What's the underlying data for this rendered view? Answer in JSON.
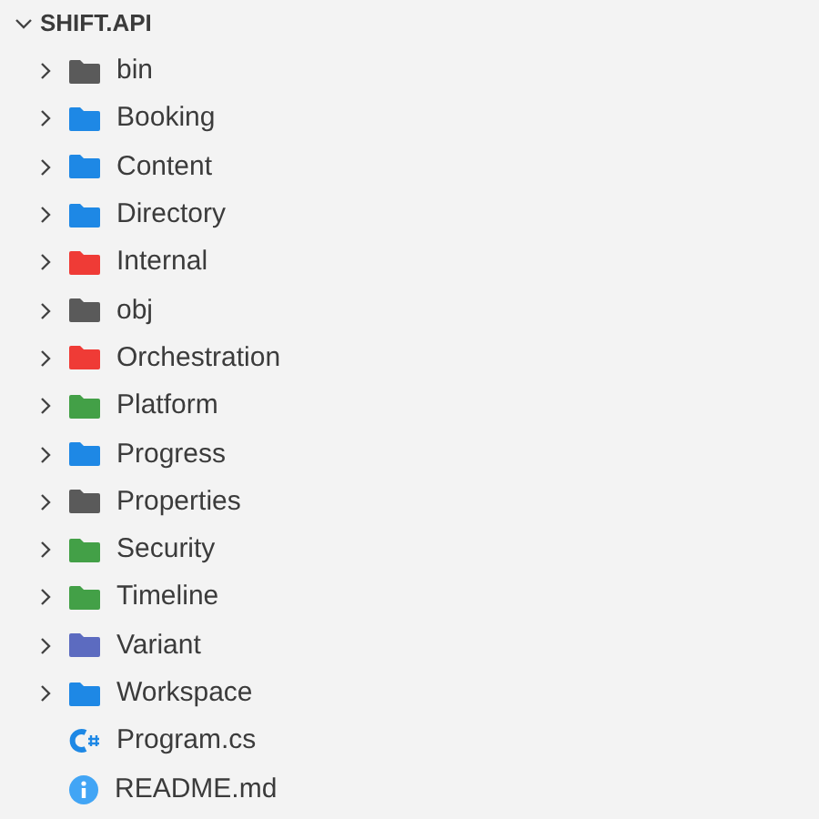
{
  "root": {
    "label": "SHIFT.API",
    "expanded": true
  },
  "items": [
    {
      "kind": "folder",
      "label": "bin",
      "color": "#5a5a5a",
      "expanded": false
    },
    {
      "kind": "folder",
      "label": "Booking",
      "color": "#1e88e5",
      "expanded": false
    },
    {
      "kind": "folder",
      "label": "Content",
      "color": "#1e88e5",
      "expanded": false
    },
    {
      "kind": "folder",
      "label": "Directory",
      "color": "#1e88e5",
      "expanded": false
    },
    {
      "kind": "folder",
      "label": "Internal",
      "color": "#ef3b36",
      "expanded": false
    },
    {
      "kind": "folder",
      "label": "obj",
      "color": "#5a5a5a",
      "expanded": false
    },
    {
      "kind": "folder",
      "label": "Orchestration",
      "color": "#ef3b36",
      "expanded": false
    },
    {
      "kind": "folder",
      "label": "Platform",
      "color": "#43a047",
      "expanded": false
    },
    {
      "kind": "folder",
      "label": "Progress",
      "color": "#1e88e5",
      "expanded": false
    },
    {
      "kind": "folder",
      "label": "Properties",
      "color": "#5a5a5a",
      "expanded": false
    },
    {
      "kind": "folder",
      "label": "Security",
      "color": "#43a047",
      "expanded": false
    },
    {
      "kind": "folder",
      "label": "Timeline",
      "color": "#43a047",
      "expanded": false
    },
    {
      "kind": "folder",
      "label": "Variant",
      "color": "#5c6bc0",
      "expanded": false
    },
    {
      "kind": "folder",
      "label": "Workspace",
      "color": "#1e88e5",
      "expanded": false
    },
    {
      "kind": "csharp",
      "label": "Program.cs"
    },
    {
      "kind": "info",
      "label": "README.md"
    }
  ]
}
